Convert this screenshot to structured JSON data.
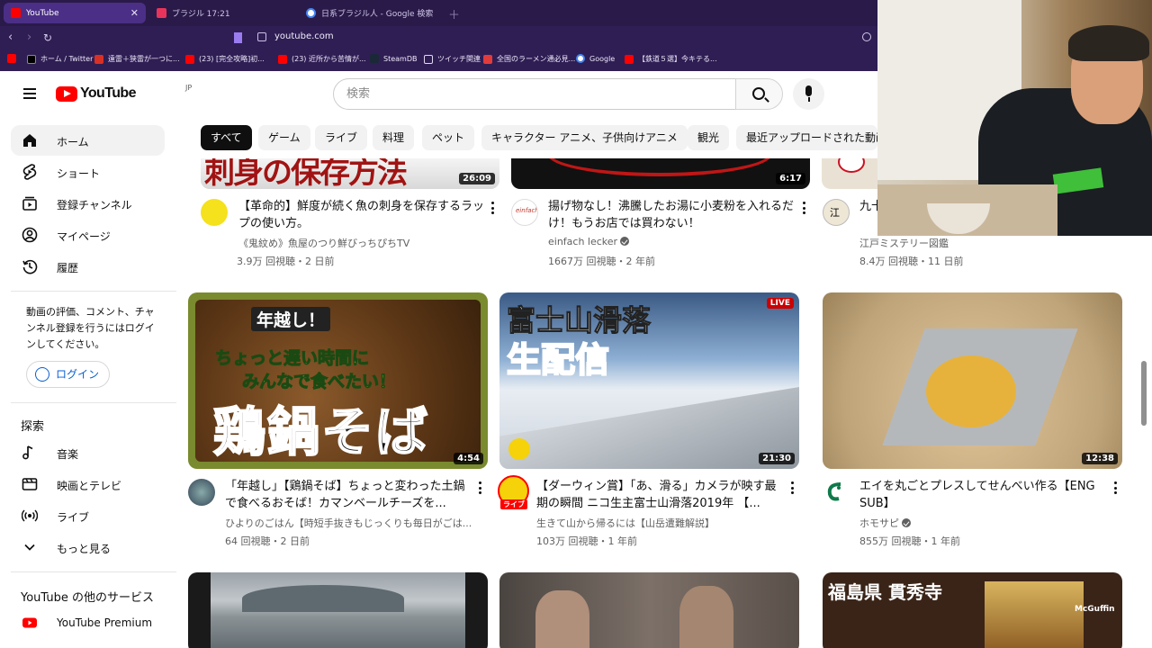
{
  "browser": {
    "tabs": [
      {
        "title": "YouTube",
        "active": true
      },
      {
        "title": "ブラジル 17:21",
        "active": false
      },
      {
        "title": "日系ブラジル人 - Google 検索",
        "active": false
      }
    ],
    "url": "youtube.com",
    "bookmarks": [
      "ホーム / Twitter",
      "遠雷＋狭雷が一つに...",
      "(23) [完全攻略]初...",
      "(23) 近所から苦情が...",
      "SteamDB",
      "ツイッチ関連",
      "全国のラーメン通必見...",
      "Google",
      "【鉄道５選】今キテる..."
    ]
  },
  "youtube": {
    "logo_text": "YouTube",
    "country_code": "JP",
    "search_placeholder": "検索",
    "chips": [
      "すべて",
      "ゲーム",
      "ライブ",
      "料理",
      "ペット",
      "キャラクター アニメ、子供向けアニメ",
      "観光",
      "最近アップロードされた動画"
    ],
    "sidebar": {
      "primary": [
        {
          "label": "ホーム",
          "icon": "home-icon"
        },
        {
          "label": "ショート",
          "icon": "shorts-icon"
        },
        {
          "label": "登録チャンネル",
          "icon": "subscriptions-icon"
        },
        {
          "label": "マイページ",
          "icon": "account-icon"
        },
        {
          "label": "履歴",
          "icon": "history-icon"
        }
      ],
      "signin_prompt": "動画の評価、コメント、チャンネル登録を行うにはログインしてください。",
      "signin_button": "ログイン",
      "explore_title": "探索",
      "explore": [
        {
          "label": "音楽",
          "icon": "music-icon"
        },
        {
          "label": "映画とテレビ",
          "icon": "film-icon"
        },
        {
          "label": "ライブ",
          "icon": "live-icon"
        },
        {
          "label": "もっと見る",
          "icon": "chevron-down-icon"
        }
      ],
      "more_title": "YouTube の他のサービス",
      "more": [
        {
          "label": "YouTube Premium",
          "icon": "youtube-premium-icon"
        }
      ]
    },
    "videos_row1": [
      {
        "title": "【革命的】鮮度が続く魚の刺身を保存するラップの使い方。",
        "channel": "《鬼紋め》魚屋のつり鮮びっちぴちTV",
        "meta": "3.9万 回視聴・2 日前",
        "duration": "26:09",
        "thumb_text": "刺身の保存方法",
        "verified": false
      },
      {
        "title": "揚げ物なし！沸騰したお湯に小麦粉を入れるだけ！もうお店では買わない！",
        "channel": "einfach lecker",
        "meta": "1667万 回視聴・2 年前",
        "duration": "6:17",
        "verified": true
      },
      {
        "title": "九十九里浜…本当",
        "channel": "江戸ミステリー図鑑",
        "meta": "8.4万 回視聴・11 日前",
        "verified": false
      }
    ],
    "videos_row2": [
      {
        "title": "「年越し」【鶏鍋そば】ちょっと変わった土鍋で食べるおそば！カマンベールチーズを...",
        "channel": "ひよりのごはん【時短手抜きもじっくりも毎日がごは...",
        "meta": "64 回視聴・2 日前",
        "duration": "4:54",
        "thumb_text_top": "年越し！",
        "thumb_text_mid": "ちょっと遅い時間に",
        "thumb_text_mid2": "みんなで食べたい！",
        "thumb_text_big": "鶏鍋そば",
        "verified": false
      },
      {
        "title": "【ダーウィン賞】「あ、滑る」カメラが映す最期の瞬間 ニコ生主富士山滑落2019年 【...",
        "channel": "生きて山から帰るには【山岳遭難解説】",
        "meta": "103万 回視聴・1 年前",
        "duration": "21:30",
        "live_badge": "LIVE",
        "thumb_text_top": "富士山滑落",
        "thumb_text_big": "生配信",
        "avatar_badge": "ライブ",
        "verified": false
      },
      {
        "title": "エイを丸ごとプレスしてせんべい作る【ENG SUB】",
        "channel": "ホモサピ",
        "meta": "855万 回視聴・1 年前",
        "duration": "12:38",
        "verified": true
      }
    ],
    "videos_row3": [
      {
        "thumb_text": ""
      },
      {
        "thumb_text": ""
      },
      {
        "thumb_text": "福島県 貫秀寺",
        "watermark": "McGuffin"
      }
    ]
  },
  "colors": {
    "accent": "#ff0000",
    "link": "#065fd4",
    "browser_chrome": "#2f1e54"
  }
}
